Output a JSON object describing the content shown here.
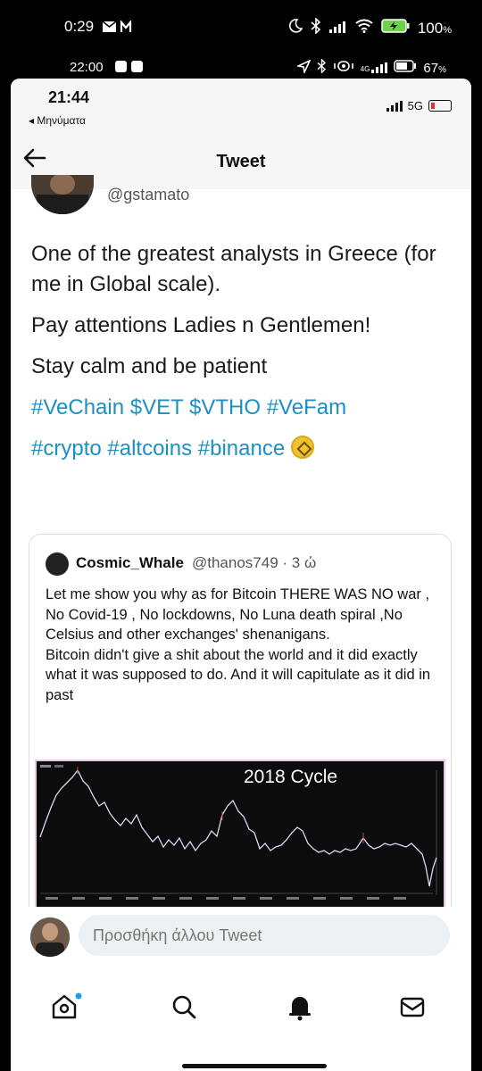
{
  "outer_status": {
    "time": "0:29",
    "battery_percent": "100",
    "battery_suffix": "%"
  },
  "second_status": {
    "time": "22:00",
    "network_label": "4G",
    "battery_percent": "67",
    "battery_suffix": "%"
  },
  "ios_status": {
    "time": "21:44",
    "back_label": "◂ Μηνύματα",
    "network": "5G"
  },
  "header": {
    "title": "Tweet"
  },
  "tweet": {
    "handle": "@gstamato",
    "lines": [
      "One of the greatest analysts in Greece (for me in Global scale).",
      "Pay attentions Ladies n Gentlemen!",
      "Stay calm and be patient"
    ],
    "hashtags_line1": "#VeChain $VET $VTHO #VeFam",
    "hashtags_line2": "#crypto #altcoins #binance"
  },
  "quote": {
    "name": "Cosmic_Whale",
    "handle": "@thanos749 · 3 ώ",
    "text_para1": "Let me show you why as for Bitcoin THERE WAS NO  war , No Covid-19 , No lockdowns, No Luna death spiral ,No Celsius and other exchanges' shenanigans.",
    "text_para2": "Bitcoin didn't give a shit about the world and it did exactly what it was supposed to do. And it will capitulate as it did in past",
    "chart_label": "2018 Cycle"
  },
  "reply": {
    "placeholder": "Προσθήκη άλλου Tweet"
  },
  "tabs": [
    {
      "icon": "home-icon"
    },
    {
      "icon": "search-icon"
    },
    {
      "icon": "bell-icon"
    },
    {
      "icon": "mail-icon"
    }
  ],
  "colors": {
    "hashtag": "#1d8fc4",
    "notification_dot": "#1d9bf0",
    "chart_line": "#d9d9f5"
  }
}
